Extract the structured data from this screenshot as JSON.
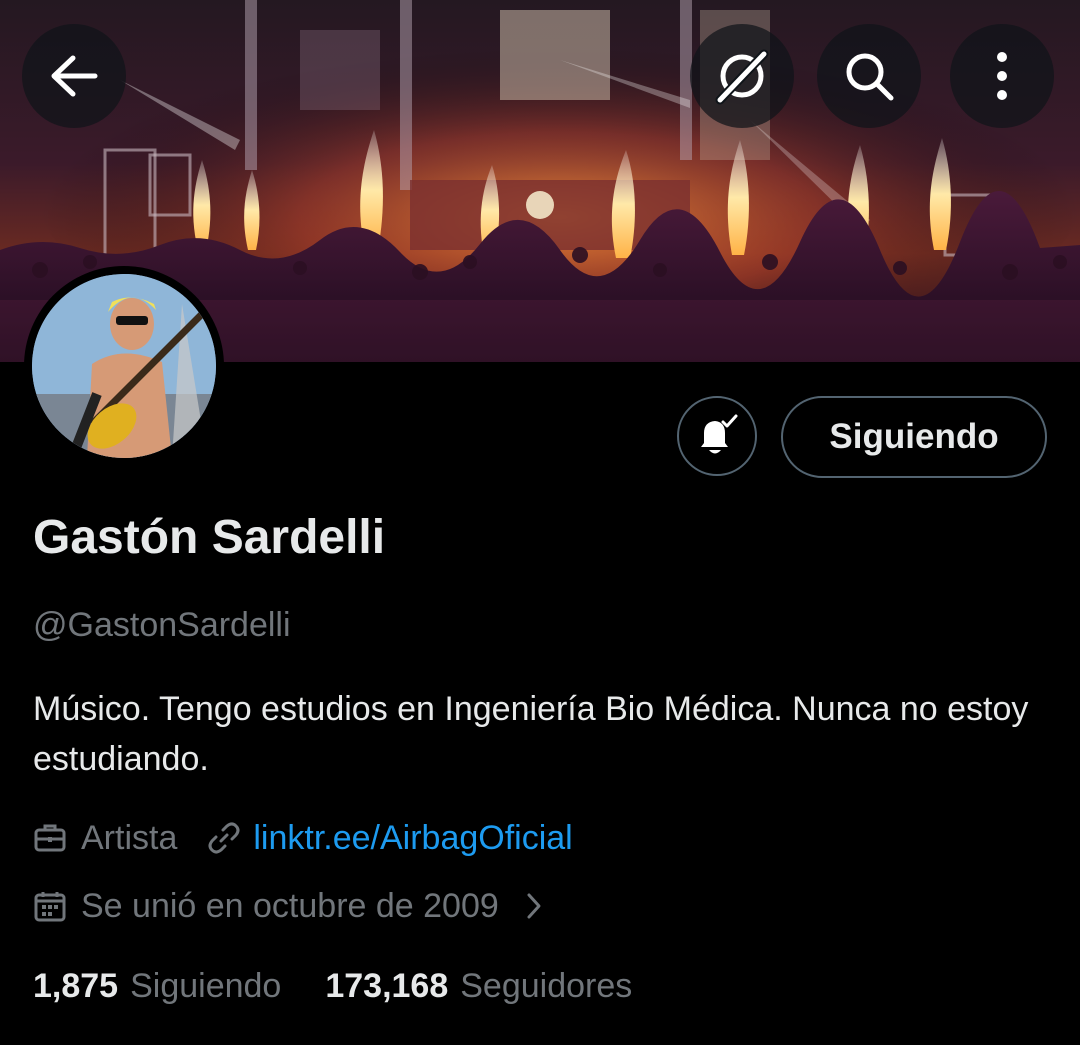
{
  "header": {
    "back_icon": "arrow-left-icon",
    "grok_icon": "grok-icon",
    "search_icon": "search-icon",
    "more_icon": "more-vertical-icon"
  },
  "profile": {
    "display_name": "Gastón Sardelli",
    "handle": "@GastonSardelli",
    "bio": "Músico. Tengo estudios en Ingeniería Bio Médica. Nunca no estoy estudiando.",
    "category": "Artista",
    "website": "linktr.ee/AirbagOficial",
    "joined": "Se unió en octubre de 2009",
    "following_count": "1,875",
    "following_label": "Siguiendo",
    "followers_count": "173,168",
    "followers_label": "Seguidores"
  },
  "actions": {
    "notifications_icon": "bell-check-icon",
    "follow_state": "Siguiendo"
  },
  "colors": {
    "background": "#000000",
    "text_primary": "#e7e9ea",
    "text_secondary": "#71767b",
    "link": "#1d9bf0",
    "border": "#536471"
  }
}
